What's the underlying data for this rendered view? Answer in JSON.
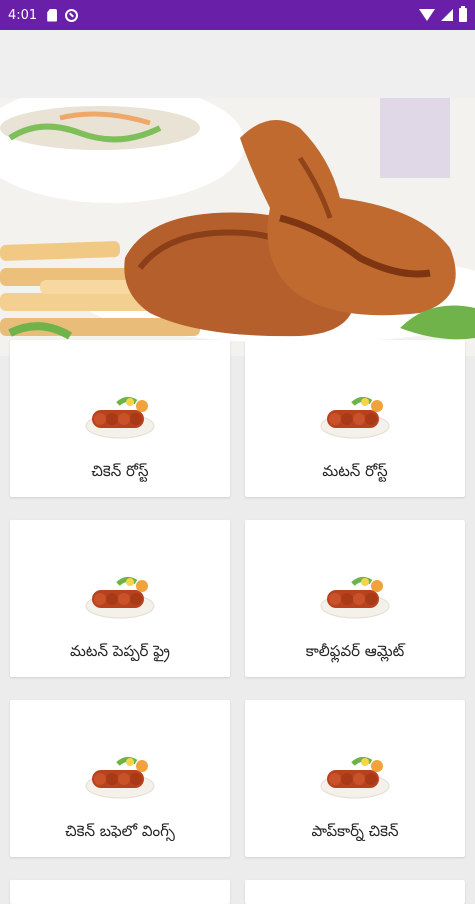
{
  "status_bar": {
    "time": "4:01",
    "left_icons": [
      "sd-card-icon",
      "do-not-disturb-icon"
    ],
    "right_icons": [
      "wifi-icon",
      "signal-icon",
      "battery-icon"
    ],
    "color": "#6a1fa8"
  },
  "banner": {
    "image": "roast-chicken-drumsticks-with-fries-banner"
  },
  "menu": {
    "items": [
      {
        "label": "చికెన్ రోస్ట్",
        "icon": "kebab-plate-icon"
      },
      {
        "label": "మటన్ రోస్ట్",
        "icon": "kebab-plate-icon"
      },
      {
        "label": "మటన్ పెప్పర్ ఫ్రై",
        "icon": "kebab-plate-icon"
      },
      {
        "label": "కాలీఫ్లవర్ ఆమ్లెట్",
        "icon": "kebab-plate-icon"
      },
      {
        "label": "చికెన్ బఫెలో వింగ్స్",
        "icon": "kebab-plate-icon"
      },
      {
        "label": "పాప్‌కార్న్ చికెన్",
        "icon": "kebab-plate-icon"
      }
    ]
  }
}
